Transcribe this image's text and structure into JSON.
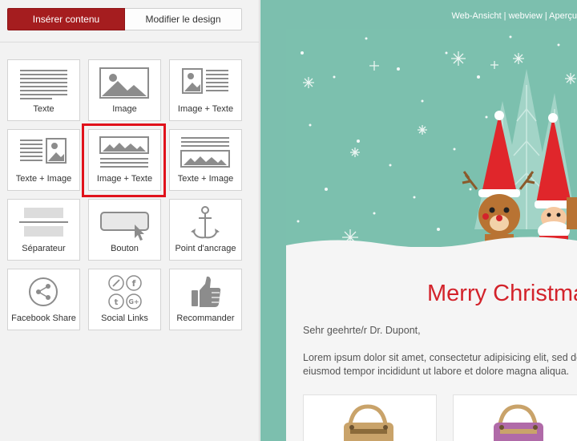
{
  "tabs": {
    "insert": "Insérer contenu",
    "design": "Modifier le design"
  },
  "blocks": [
    {
      "label": "Texte",
      "icon": "text-block-icon"
    },
    {
      "label": "Image",
      "icon": "image-block-icon"
    },
    {
      "label": "Image + Texte",
      "icon": "image-text-block-icon"
    },
    {
      "label": "Texte + Image",
      "icon": "text-image-block-icon"
    },
    {
      "label": "Image + Texte",
      "icon": "image-over-text-block-icon"
    },
    {
      "label": "Texte + Image",
      "icon": "text-over-image-block-icon"
    },
    {
      "label": "Séparateur",
      "icon": "separator-block-icon"
    },
    {
      "label": "Bouton",
      "icon": "button-block-icon"
    },
    {
      "label": "Point d'ancrage",
      "icon": "anchor-icon"
    },
    {
      "label": "Facebook Share",
      "icon": "share-icon"
    },
    {
      "label": "Social Links",
      "icon": "social-links-icon"
    },
    {
      "label": "Recommander",
      "icon": "thumbs-up-icon"
    }
  ],
  "preview": {
    "web_links": "Web-Ansicht | webview | Aperçu",
    "title": "Merry Christmas",
    "greeting": "Sehr geehrte/r Dr. Dupont,",
    "body": "Lorem ipsum dolor sit amet, consectetur adipisicing elit, sed do eiusmod tempor incididunt ut labore et dolore magna aliqua."
  },
  "colors": {
    "accent": "#a51d1f",
    "preview_bg": "#7cbfae",
    "title": "#d3232b",
    "highlight": "#e0121b"
  }
}
